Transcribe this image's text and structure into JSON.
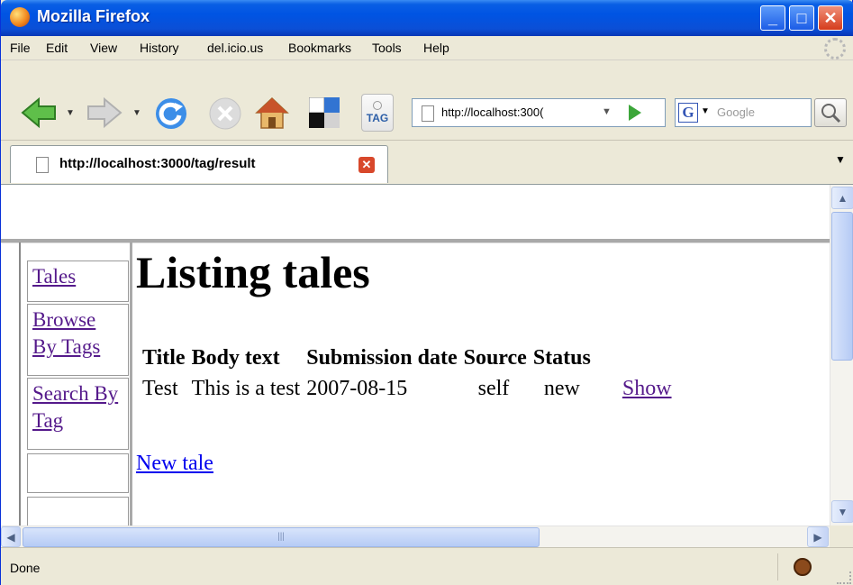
{
  "window": {
    "title": "Mozilla Firefox",
    "controls": {
      "minimize": "_",
      "maximize": "□",
      "close": "✕"
    }
  },
  "menubar": {
    "items": [
      "File",
      "Edit",
      "View",
      "History",
      "del.icio.us",
      "Bookmarks",
      "Tools",
      "Help"
    ]
  },
  "toolbar": {
    "tag_label": "TAG",
    "url": "http://localhost:3000/tag/result",
    "url_visible": "http://localhost:300(",
    "search_placeholder": "Google",
    "search_engine_glyph": "G",
    "icons": [
      "back-icon",
      "forward-icon",
      "reload-icon",
      "stop-icon",
      "home-icon",
      "delicious-icon",
      "tag-icon",
      "go-icon",
      "magnifier-icon"
    ]
  },
  "tabs": [
    {
      "label": "http://localhost:3000/tag/result",
      "active": true
    }
  ],
  "sidebar": {
    "links": [
      {
        "label": "Tales"
      },
      {
        "label": "Browse By Tags"
      },
      {
        "label": "Search By Tag"
      }
    ]
  },
  "main": {
    "heading": "Listing tales",
    "columns": [
      "Title",
      "Body text",
      "Submission date",
      "Source",
      "Status"
    ],
    "rows": [
      {
        "title": "Test",
        "body": "This is a test",
        "date": "2007-08-15",
        "source": "self",
        "status": "new",
        "action": "Show"
      }
    ],
    "new_link": "New tale"
  },
  "statusbar": {
    "text": "Done"
  },
  "colors": {
    "titlebar": "#0054e3",
    "visited_link": "#551a8b",
    "unvisited_link": "#0000ee",
    "chrome": "#ece9d8"
  }
}
